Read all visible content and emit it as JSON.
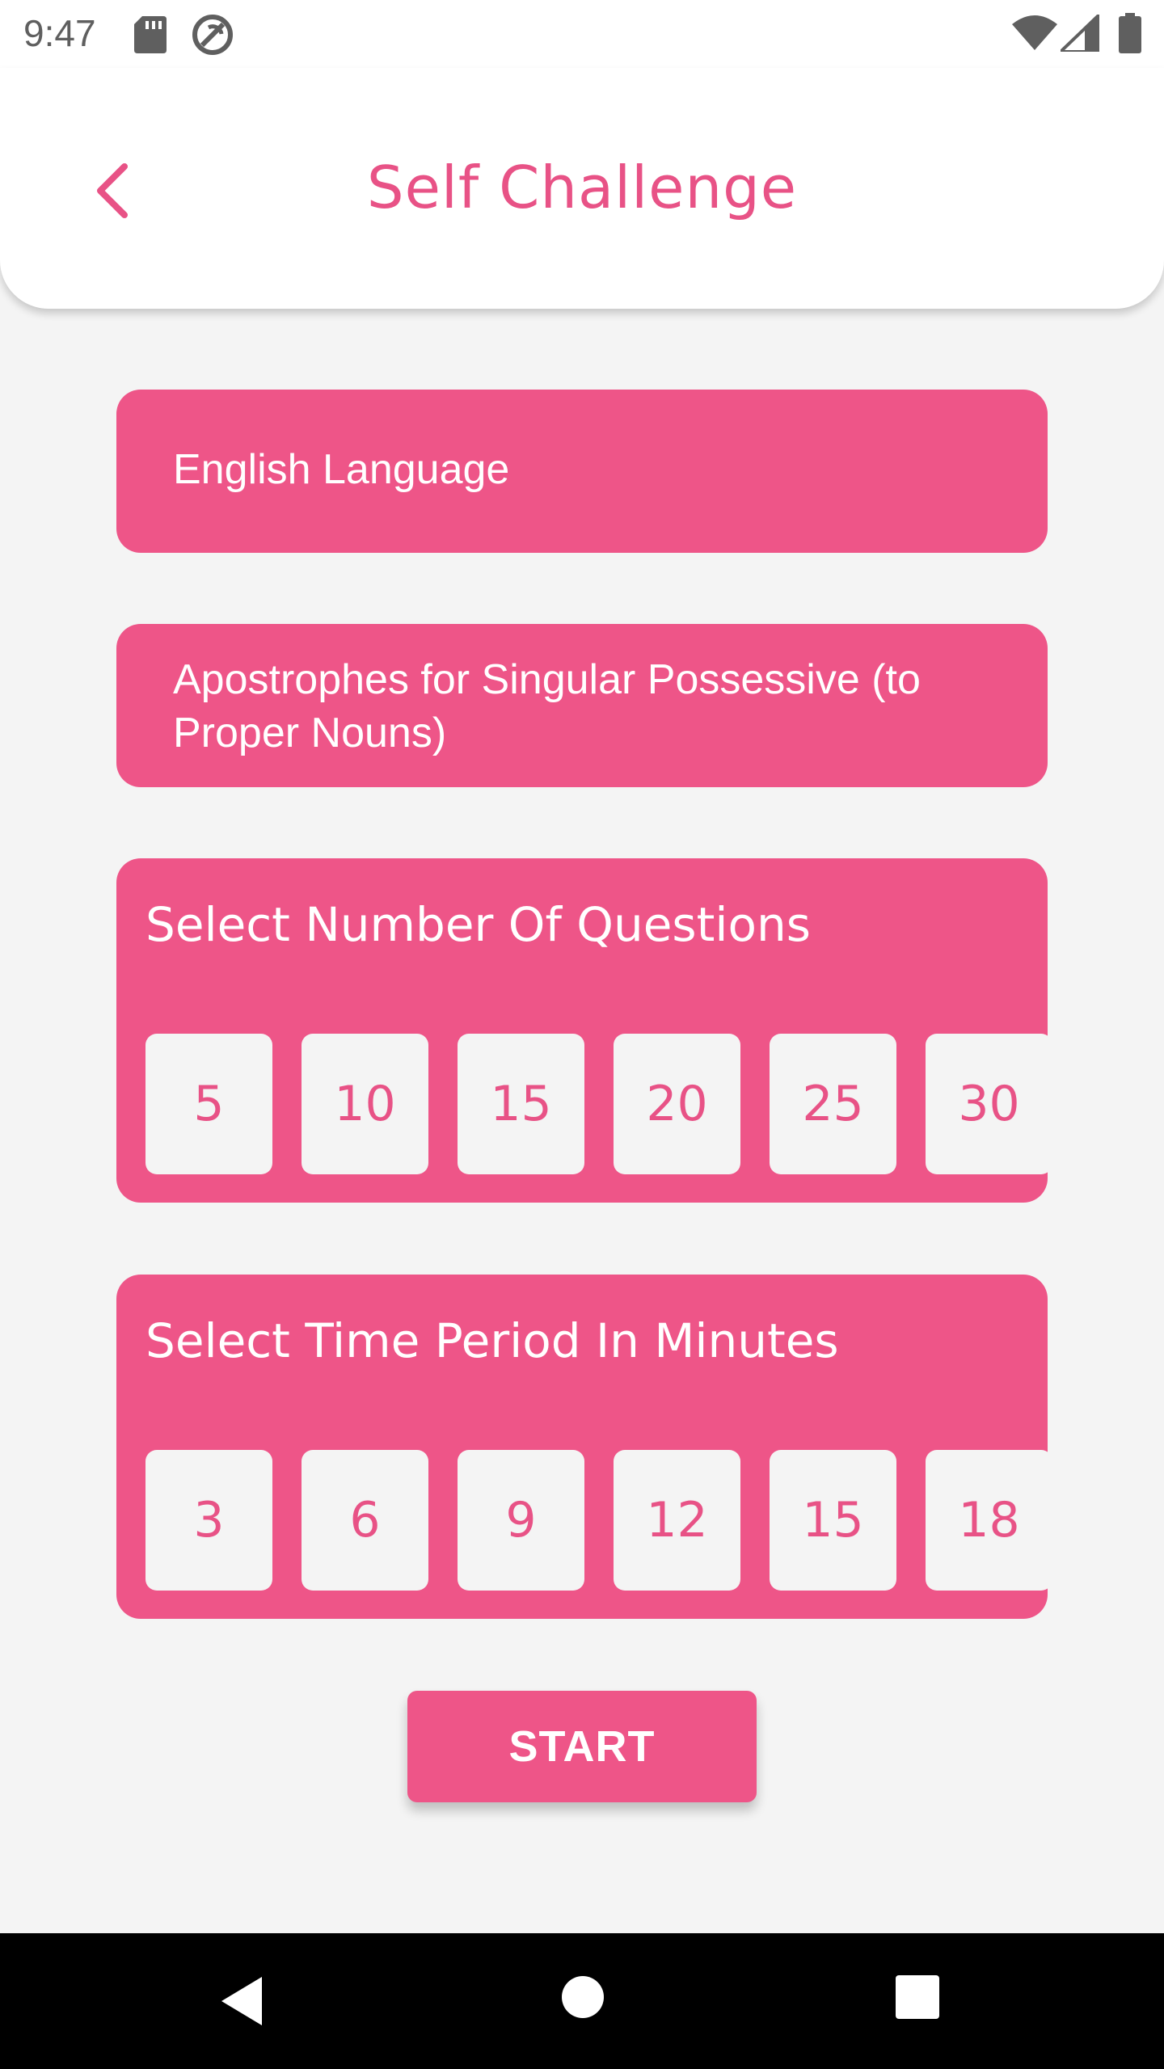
{
  "status_bar": {
    "time": "9:47",
    "icons": [
      "sd-card-icon",
      "sync-icon",
      "wifi-icon",
      "signal-icon",
      "battery-icon"
    ]
  },
  "header": {
    "title": "Self Challenge",
    "back_icon": "chevron-left-icon"
  },
  "subject": {
    "label": "English Language"
  },
  "topic": {
    "label": "Apostrophes for Singular Possessive (to Proper Nouns)"
  },
  "questions": {
    "heading": "Select Number Of Questions",
    "options": [
      "5",
      "10",
      "15",
      "20",
      "25",
      "30"
    ]
  },
  "time_period": {
    "heading": "Select Time Period In Minutes",
    "options": [
      "3",
      "6",
      "9",
      "12",
      "15",
      "18"
    ]
  },
  "start_button": {
    "label": "START"
  },
  "colors": {
    "accent": "#ee5588",
    "title": "#e85286",
    "background": "#f4f4f4",
    "chip": "#f4f4f4"
  },
  "nav_bar": {
    "icons": [
      "back-triangle-icon",
      "home-circle-icon",
      "recents-square-icon"
    ]
  }
}
